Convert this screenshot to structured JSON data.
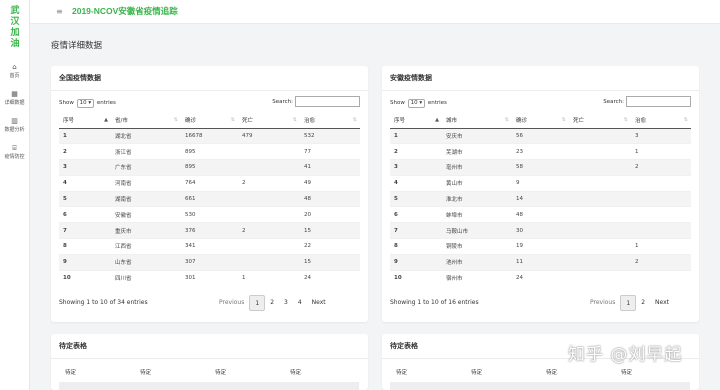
{
  "sidebar": {
    "logo": [
      "武",
      "汉",
      "加",
      "油"
    ],
    "items": [
      {
        "icon": "home-icon",
        "glyph": "⌂",
        "label": "首页"
      },
      {
        "icon": "grid-icon",
        "glyph": "▦",
        "label": "详细数据"
      },
      {
        "icon": "bar-chart-icon",
        "glyph": "▥",
        "label": "数据分析"
      },
      {
        "icon": "bank-icon",
        "glyph": "⌸",
        "label": "疫情防控"
      }
    ]
  },
  "topbar": {
    "title": "2019-NCOV安徽省疫情追踪",
    "menu_icon": "≡"
  },
  "page": {
    "title": "疫情详细数据"
  },
  "national": {
    "title": "全国疫情数据",
    "length": {
      "prefix": "Show",
      "value": "10",
      "suffix": "entries"
    },
    "search_label": "Search:",
    "columns": [
      "序号",
      "省/市",
      "确诊",
      "死亡",
      "治愈"
    ],
    "rows": [
      [
        "1",
        "湖北省",
        "16678",
        "479",
        "532"
      ],
      [
        "2",
        "浙江省",
        "895",
        "",
        "77"
      ],
      [
        "3",
        "广东省",
        "895",
        "",
        "41"
      ],
      [
        "4",
        "河南省",
        "764",
        "2",
        "49"
      ],
      [
        "5",
        "湖南省",
        "661",
        "",
        "48"
      ],
      [
        "6",
        "安徽省",
        "530",
        "",
        "20"
      ],
      [
        "7",
        "重庆市",
        "376",
        "2",
        "15"
      ],
      [
        "8",
        "江西省",
        "341",
        "",
        "22"
      ],
      [
        "9",
        "山东省",
        "307",
        "",
        "15"
      ],
      [
        "10",
        "四川省",
        "301",
        "1",
        "24"
      ]
    ],
    "info": "Showing 1 to 10 of 34 entries",
    "pager": {
      "previous": "Previous",
      "pages": [
        "1",
        "2",
        "3",
        "4"
      ],
      "next": "Next"
    }
  },
  "anhui": {
    "title": "安徽疫情数据",
    "length": {
      "prefix": "Show",
      "value": "10",
      "suffix": "entries"
    },
    "search_label": "Search:",
    "columns": [
      "序号",
      "城市",
      "确诊",
      "死亡",
      "治愈"
    ],
    "rows": [
      [
        "1",
        "安庆市",
        "56",
        "",
        "3"
      ],
      [
        "2",
        "芜湖市",
        "23",
        "",
        "1"
      ],
      [
        "3",
        "亳州市",
        "58",
        "",
        "2"
      ],
      [
        "4",
        "黄山市",
        "9",
        "",
        ""
      ],
      [
        "5",
        "淮北市",
        "14",
        "",
        ""
      ],
      [
        "6",
        "蚌埠市",
        "48",
        "",
        ""
      ],
      [
        "7",
        "马鞍山市",
        "30",
        "",
        ""
      ],
      [
        "8",
        "铜陵市",
        "19",
        "",
        "1"
      ],
      [
        "9",
        "池州市",
        "11",
        "",
        "2"
      ],
      [
        "10",
        "宿州市",
        "24",
        "",
        ""
      ]
    ],
    "info": "Showing 1 to 10 of 16 entries",
    "pager": {
      "previous": "Previous",
      "pages": [
        "1",
        "2"
      ],
      "next": "Next"
    }
  },
  "pending_left": {
    "title": "待定表格",
    "columns": [
      "待定",
      "待定",
      "待定",
      "待定"
    ]
  },
  "pending_right": {
    "title": "待定表格",
    "columns": [
      "待定",
      "待定",
      "待定",
      "待定"
    ]
  },
  "watermark": "知乎 @刘早起",
  "colors": {
    "brand": "#39b54a",
    "stripe": "#f4f4f4"
  }
}
